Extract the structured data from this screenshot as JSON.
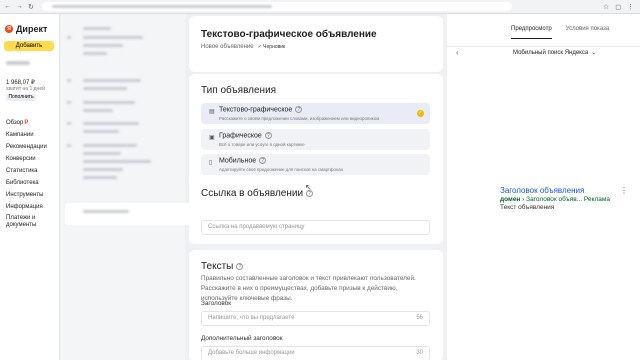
{
  "app": {
    "brand": "Директ",
    "logo_letter": "Я"
  },
  "sidebar": {
    "add_label": "Добавить",
    "balance": "1 968,07 ₽",
    "balance_sub": "хватит на 1 дней",
    "topup_label": "Пополнить",
    "items": [
      {
        "label": "Обзор",
        "badge": "P"
      },
      {
        "label": "Кампании"
      },
      {
        "label": "Рекомендации"
      },
      {
        "label": "Конверсии"
      },
      {
        "label": "Статистика"
      },
      {
        "label": "Библиотека"
      },
      {
        "label": "Инструменты"
      },
      {
        "label": "Информация"
      },
      {
        "label": "Платежи и документы"
      }
    ]
  },
  "editor": {
    "title": "Текстово-графическое объявление",
    "subtitle": "Новое объявление",
    "draft": "✓ Черновик",
    "type_section": {
      "title": "Тип объявления",
      "options": [
        {
          "label": "Текстово-графическое",
          "desc": "Расскажите о своём предложении словами, изображением или видеороликом",
          "selected": true
        },
        {
          "label": "Графическое",
          "desc": "Всё о товаре или услуге в одной картинке",
          "selected": false
        },
        {
          "label": "Мобильное",
          "desc": "Адаптируйте своё предложение для поисков на смартфонах",
          "selected": false
        }
      ]
    },
    "link_section": {
      "title": "Ссылка в объявлении",
      "placeholder": "Ссылка на продаваемую страницу"
    },
    "texts_section": {
      "title": "Тексты",
      "description": "Правильно составленные заголовок и текст привлекают пользователей. Расскажите в них о преимуществах, добавьте призыв к действию, используйте ключевые фразы.",
      "headline_label": "Заголовок",
      "headline_placeholder": "Напишите, что вы предлагаете",
      "headline_limit": "56",
      "extra_label": "Дополнительный заголовок",
      "extra_placeholder": "Добавьте больше информации",
      "extra_limit": "30"
    }
  },
  "preview": {
    "tabs": [
      "Предпросмотр",
      "Условия показа"
    ],
    "active_tab": 0,
    "device": "Мобильный поиск Яндекса",
    "ad": {
      "title": "Заголовок объявления",
      "domain": "домен",
      "url_rest": " › Заголовок объяв... ",
      "ad_label": "Реклама",
      "text": "Текст объявления"
    }
  },
  "colors": {
    "accent": "#ffdb4d",
    "link": "#1a57d8",
    "url": "#006629",
    "brand": "#fc3f1d"
  },
  "icons": [
    "back-icon",
    "forward-icon",
    "reload-icon",
    "menu-icon",
    "help-icon",
    "check-icon",
    "chevron-left-icon",
    "chevron-down-icon",
    "more-icon"
  ]
}
